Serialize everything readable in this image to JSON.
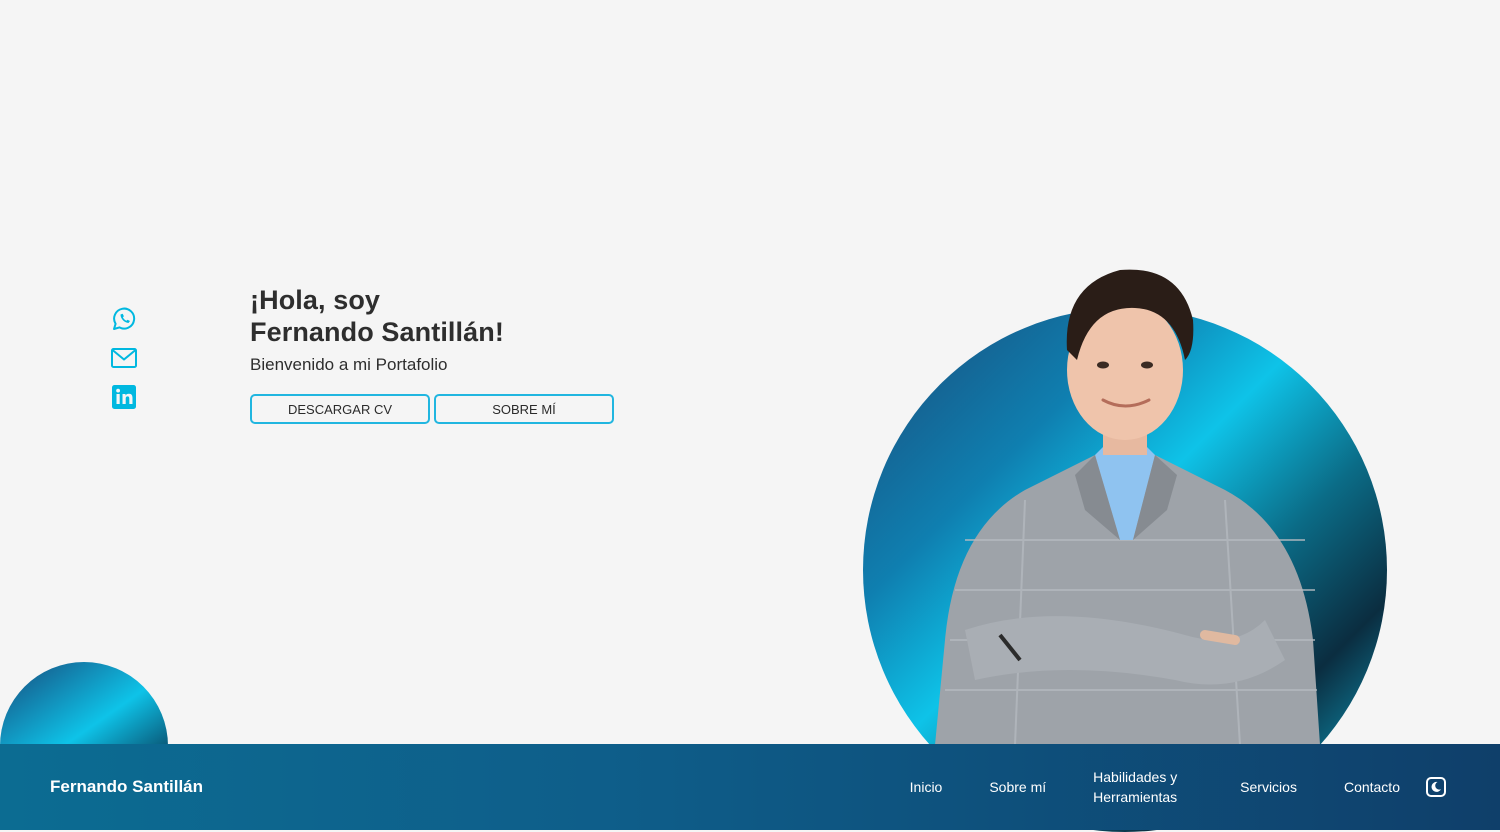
{
  "hero": {
    "greeting_line1": "¡Hola, soy",
    "greeting_line2": "Fernando Santillán!",
    "subtitle": "Bienvenido a mi Portafolio",
    "buttons": {
      "download_cv": "DESCARGAR CV",
      "about_me": "SOBRE MÍ"
    }
  },
  "social": [
    {
      "icon": "whatsapp-icon"
    },
    {
      "icon": "mail-icon"
    },
    {
      "icon": "linkedin-icon"
    }
  ],
  "navbar": {
    "brand": "Fernando Santillán",
    "items": [
      {
        "label": "Inicio"
      },
      {
        "label": "Sobre mí"
      },
      {
        "label": "Habilidades y Herramientas"
      },
      {
        "label": "Servicios"
      },
      {
        "label": "Contacto"
      }
    ],
    "theme_toggle_icon": "moon-icon"
  },
  "colors": {
    "accent": "#21b6e0",
    "navbar_start": "#0c6c92",
    "navbar_end": "#0f3f6a",
    "background": "#f5f5f5"
  }
}
